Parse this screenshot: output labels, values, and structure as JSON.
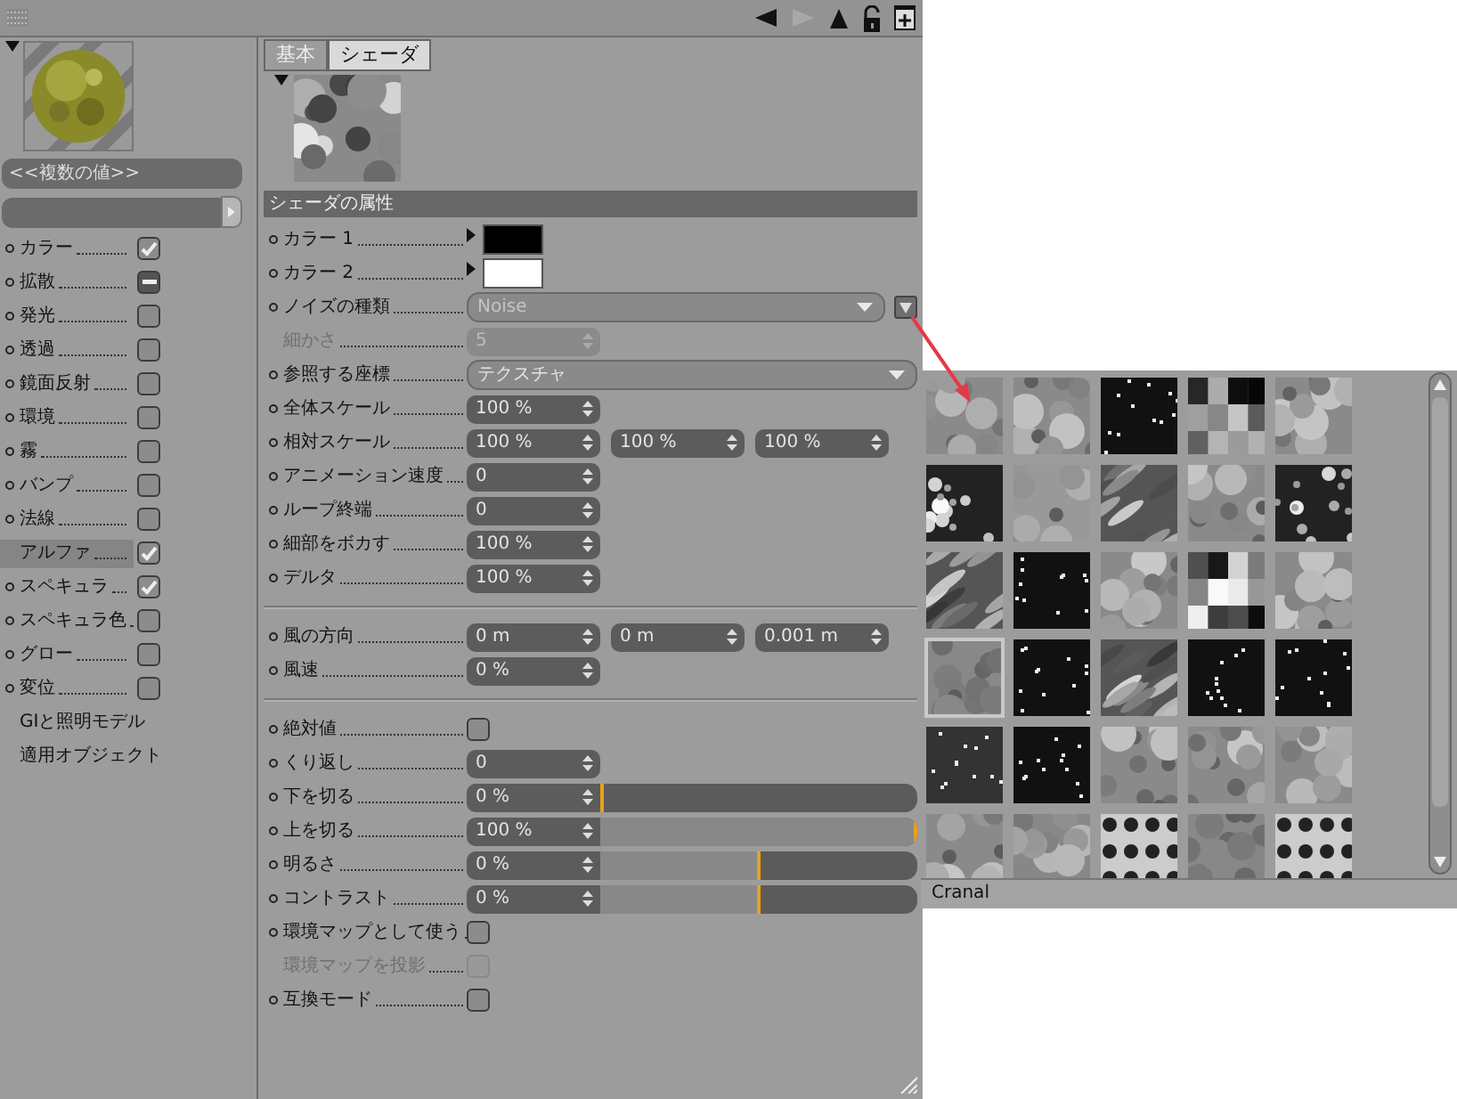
{
  "toolbar": {
    "buttons": [
      {
        "kind": "back",
        "disabled": false
      },
      {
        "kind": "forward",
        "disabled": true
      },
      {
        "kind": "up",
        "disabled": false
      },
      {
        "kind": "lock",
        "disabled": false
      },
      {
        "kind": "new",
        "disabled": false
      }
    ]
  },
  "material": {
    "expanded": true,
    "name_field": "<<複数の値>>"
  },
  "channels": [
    {
      "label": "カラー",
      "kind": "checkbox",
      "checked": true,
      "selected": false
    },
    {
      "label": "拡散",
      "kind": "mixed",
      "checked": true,
      "selected": false
    },
    {
      "label": "発光",
      "kind": "checkbox",
      "checked": false,
      "selected": false
    },
    {
      "label": "透過",
      "kind": "checkbox",
      "checked": false,
      "selected": false
    },
    {
      "label": "鏡面反射",
      "kind": "checkbox",
      "checked": false,
      "selected": false
    },
    {
      "label": "環境",
      "kind": "checkbox",
      "checked": false,
      "selected": false
    },
    {
      "label": "霧",
      "kind": "checkbox",
      "checked": false,
      "selected": false
    },
    {
      "label": "バンプ",
      "kind": "checkbox",
      "checked": false,
      "selected": false
    },
    {
      "label": "法線",
      "kind": "checkbox",
      "checked": false,
      "selected": false
    },
    {
      "label": "アルファ",
      "kind": "checkbox",
      "checked": true,
      "selected": true
    },
    {
      "label": "スペキュラ",
      "kind": "checkbox",
      "checked": true,
      "selected": false
    },
    {
      "label": "スペキュラ色",
      "kind": "checkbox",
      "checked": false,
      "selected": false
    },
    {
      "label": "グロー",
      "kind": "checkbox",
      "checked": false,
      "selected": false
    },
    {
      "label": "変位",
      "kind": "checkbox",
      "checked": false,
      "selected": false
    },
    {
      "label": "GIと照明モデル",
      "kind": "page",
      "selected": false
    },
    {
      "label": "適用オブジェクト",
      "kind": "page",
      "selected": false
    }
  ],
  "tabs": [
    {
      "label": "基本",
      "selected": false
    },
    {
      "label": "シェーダ",
      "selected": true
    }
  ],
  "shader": {
    "expanded": true
  },
  "attributes": {
    "title": "シェーダの属性",
    "groups": [
      {
        "rows": [
          {
            "label": "カラー 1",
            "kind": "color",
            "color": "#000000",
            "disabled": false
          },
          {
            "label": "カラー 2",
            "kind": "color",
            "color": "#ffffff",
            "disabled": false
          },
          {
            "label": "ノイズの種類",
            "kind": "dropdown",
            "value": "Noise",
            "value_greyed": true,
            "gallery_button": true,
            "disabled": false
          },
          {
            "label": "細かさ",
            "kind": "number",
            "values": [
              "5"
            ],
            "disabled": true
          },
          {
            "label": "参照する座標",
            "kind": "dropdown",
            "value": "テクスチャ",
            "value_greyed": false,
            "gallery_button": false,
            "disabled": false
          },
          {
            "label": "全体スケール",
            "kind": "number",
            "values": [
              "100 %"
            ],
            "disabled": false
          },
          {
            "label": "相対スケール",
            "kind": "number",
            "values": [
              "100 %",
              "100 %",
              "100 %"
            ],
            "disabled": false
          },
          {
            "label": "アニメーション速度",
            "kind": "number",
            "values": [
              "0"
            ],
            "disabled": false
          },
          {
            "label": "ループ終端",
            "kind": "number",
            "values": [
              "0"
            ],
            "disabled": false
          },
          {
            "label": "細部をボカす",
            "kind": "number",
            "values": [
              "100 %"
            ],
            "disabled": false
          },
          {
            "label": "デルタ",
            "kind": "number",
            "values": [
              "100 %"
            ],
            "disabled": false
          }
        ]
      },
      {
        "rows": [
          {
            "label": "風の方向",
            "kind": "number",
            "values": [
              "0 m",
              "0 m",
              "0.001 m"
            ],
            "disabled": false
          },
          {
            "label": "風速",
            "kind": "number",
            "values": [
              "0 %"
            ],
            "disabled": false
          }
        ]
      },
      {
        "rows": [
          {
            "label": "絶対値",
            "kind": "checkbox",
            "checked": false,
            "disabled": false
          },
          {
            "label": "くり返し",
            "kind": "number",
            "values": [
              "0"
            ],
            "disabled": false
          },
          {
            "label": "下を切る",
            "kind": "slider",
            "value": "0 %",
            "level": 0,
            "disabled": false
          },
          {
            "label": "上を切る",
            "kind": "slider",
            "value": "100 %",
            "level": 1,
            "disabled": false
          },
          {
            "label": "明るさ",
            "kind": "slider",
            "value": "0 %",
            "level": 0.5,
            "disabled": false
          },
          {
            "label": "コントラスト",
            "kind": "slider",
            "value": "0 %",
            "level": 0.5,
            "disabled": false
          },
          {
            "label": "環境マップとして使う",
            "kind": "checkbox",
            "checked": false,
            "disabled": false
          },
          {
            "label": "環境マップを投影",
            "kind": "checkbox",
            "checked": false,
            "disabled": true
          },
          {
            "label": "互換モード",
            "kind": "checkbox",
            "checked": false,
            "disabled": false
          }
        ]
      }
    ]
  },
  "gallery": {
    "caption": "Cranal",
    "tiles": [
      {
        "selected": false
      },
      {
        "selected": false
      },
      {
        "selected": false
      },
      {
        "selected": false
      },
      {
        "selected": false
      },
      {
        "selected": false
      },
      {
        "selected": false
      },
      {
        "selected": false
      },
      {
        "selected": false
      },
      {
        "selected": false
      },
      {
        "selected": false
      },
      {
        "selected": false
      },
      {
        "selected": false
      },
      {
        "selected": false
      },
      {
        "selected": false
      },
      {
        "selected": true
      },
      {
        "selected": false
      },
      {
        "selected": false
      },
      {
        "selected": false
      },
      {
        "selected": false
      },
      {
        "selected": false
      },
      {
        "selected": false
      },
      {
        "selected": false
      },
      {
        "selected": false
      },
      {
        "selected": false
      },
      {
        "selected": false
      },
      {
        "selected": false
      },
      {
        "selected": false
      },
      {
        "selected": false
      },
      {
        "selected": false
      }
    ]
  }
}
